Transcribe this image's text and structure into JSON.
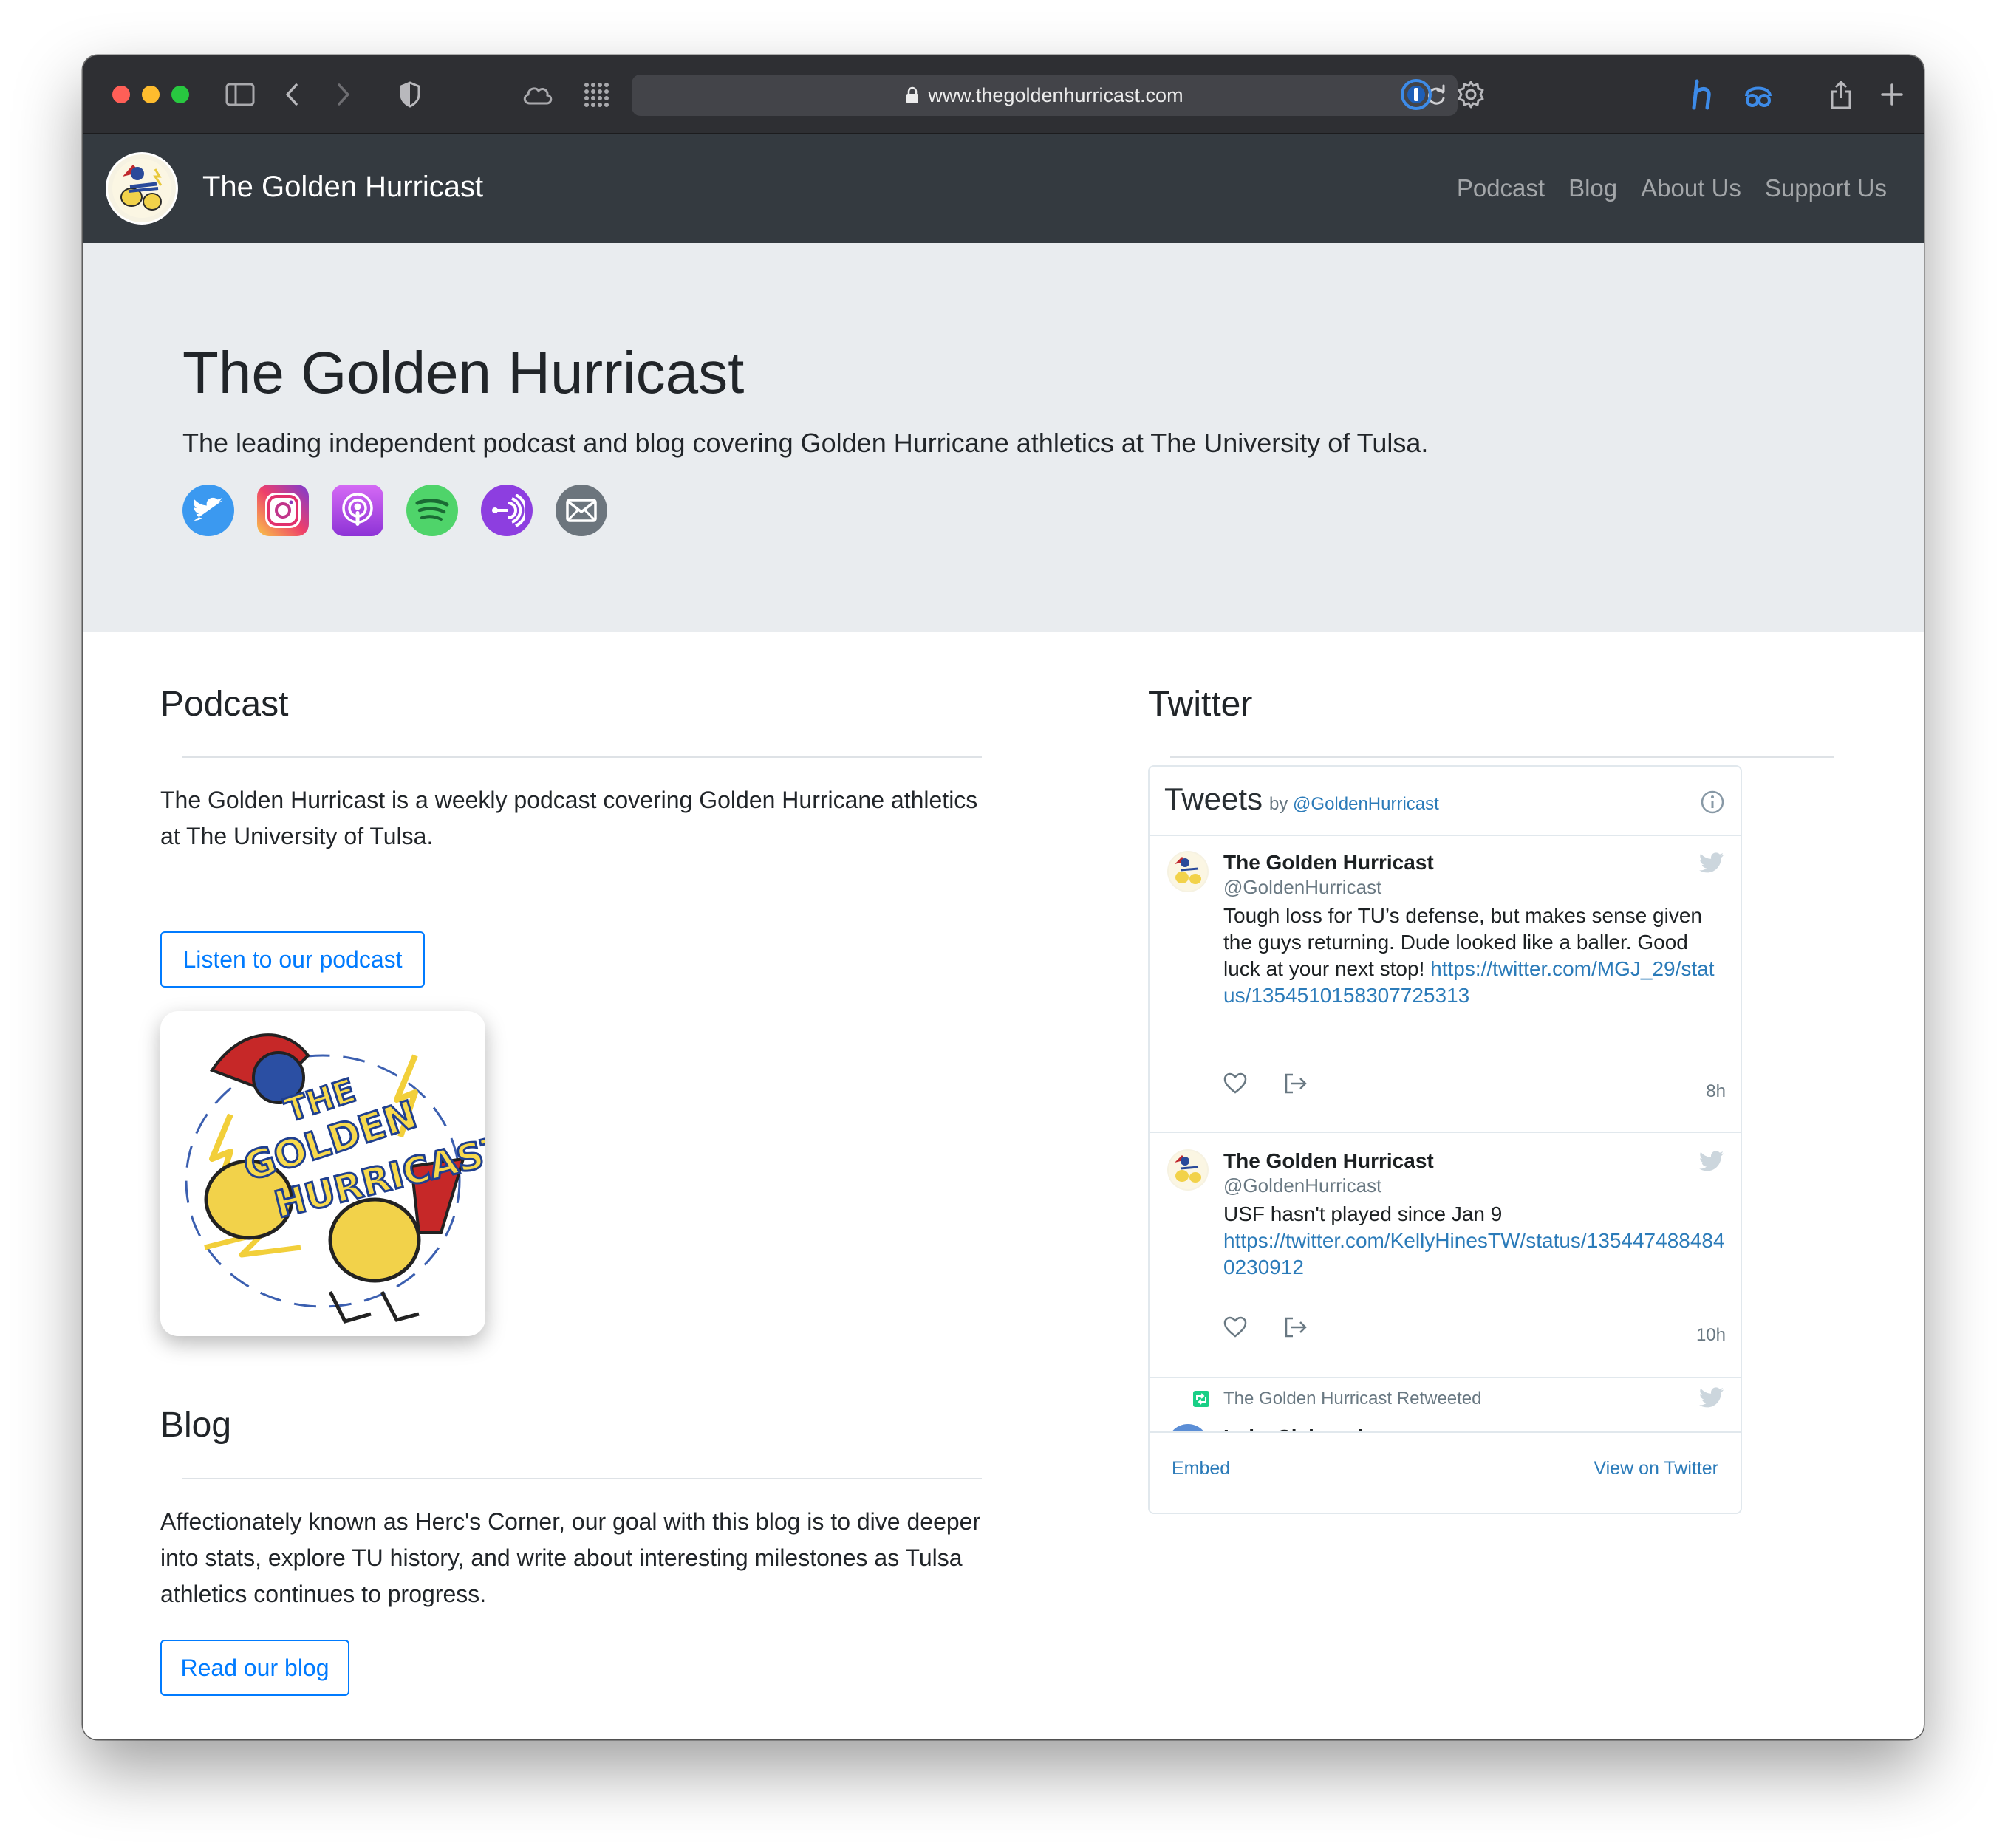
{
  "browser": {
    "url": "www.thegoldenhurricast.com"
  },
  "navbar": {
    "brand": "The Golden Hurricast",
    "links": [
      "Podcast",
      "Blog",
      "About Us",
      "Support Us"
    ]
  },
  "hero": {
    "title": "The Golden Hurricast",
    "lead": "The leading independent podcast and blog covering Golden Hurricane athletics at The University of Tulsa.",
    "social_icons": [
      "twitter-icon",
      "instagram-icon",
      "apple-podcasts-icon",
      "spotify-icon",
      "anchor-icon",
      "email-icon"
    ]
  },
  "podcast": {
    "heading": "Podcast",
    "description": "The Golden Hurricast is a weekly podcast covering Golden Hurricane athletics at The University of Tulsa.",
    "button": "Listen to our podcast"
  },
  "blog": {
    "heading": "Blog",
    "description": "Affectionately known as Herc's Corner, our goal with this blog is to dive deeper into stats, explore TU history, and write about interesting milestones as Tulsa athletics continues to progress.",
    "button": "Read our blog"
  },
  "twitter": {
    "heading": "Twitter",
    "widget_title": "Tweets",
    "by": "by",
    "by_handle": "@GoldenHurricast",
    "tweets": [
      {
        "name": "The Golden Hurricast",
        "handle": "@GoldenHurricast",
        "text": "Tough loss for TU’s defense, but makes sense given the guys returning. Dude looked like a baller. Good luck at your next stop!",
        "link": "https://twitter.com/MGJ_29/status/1354510158307725313",
        "time": "8h"
      },
      {
        "name": "The Golden Hurricast",
        "handle": "@GoldenHurricast",
        "text": "USF hasn't played since Jan 9",
        "link": "https://twitter.com/KellyHinesTW/status/1354474884840230912",
        "time": "10h"
      }
    ],
    "retweet_label": "The Golden Hurricast Retweeted",
    "retweet_partial_name": "Luke Slabaugh",
    "footer_embed": "Embed",
    "footer_view": "View on Twitter"
  },
  "colors": {
    "navbar": "#343a40",
    "jumbotron": "#e9ecef",
    "primary": "#007bff",
    "twitter_link": "#2b7bb9"
  }
}
